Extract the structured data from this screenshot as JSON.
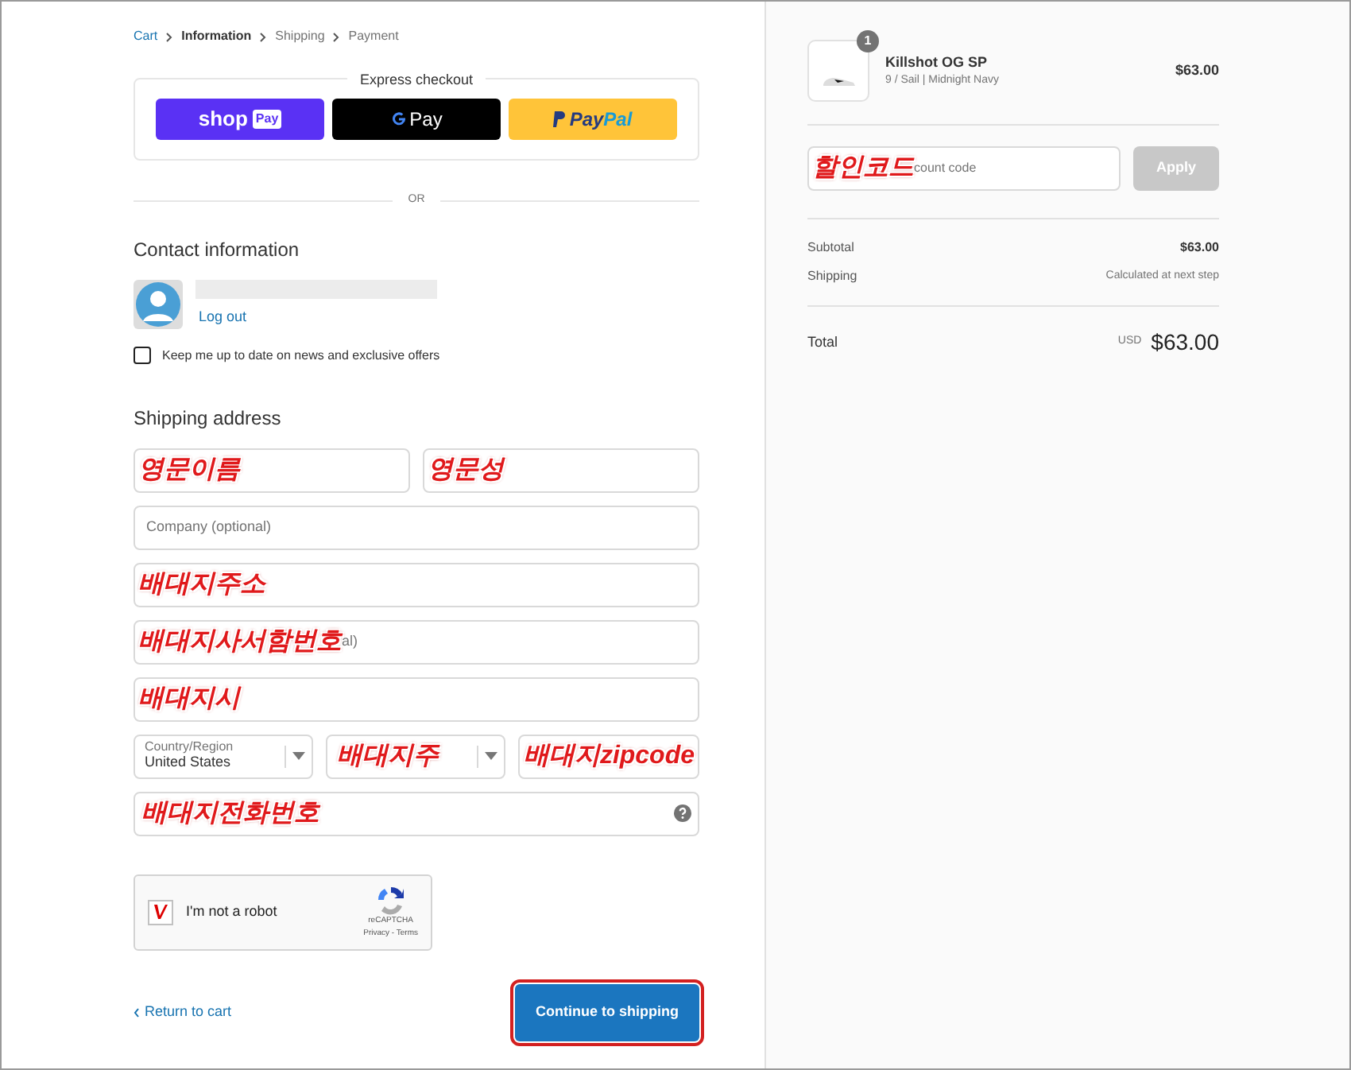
{
  "breadcrumbs": [
    {
      "label": "Cart",
      "kind": "link"
    },
    {
      "label": "Information",
      "kind": "current"
    },
    {
      "label": "Shipping",
      "kind": "future"
    },
    {
      "label": "Payment",
      "kind": "future"
    }
  ],
  "express_checkout": {
    "title": "Express checkout",
    "buttons": [
      {
        "kind": "shop",
        "label": "shop",
        "badge": "Pay"
      },
      {
        "kind": "gpay",
        "label": "Pay"
      },
      {
        "kind": "paypal",
        "label": "Pay",
        "label2": "Pal"
      }
    ]
  },
  "divider": "OR",
  "contact": {
    "title": "Contact information",
    "logout": "Log out",
    "newsletter": {
      "label": "Keep me up to date on news and exclusive offers",
      "checked": false
    }
  },
  "shipping": {
    "title": "Shipping address",
    "fields": [
      {
        "kind": "half",
        "annotation": "영문이름"
      },
      {
        "kind": "half",
        "annotation": "영문성"
      },
      {
        "kind": "text",
        "placeholder": "Company (optional)"
      },
      {
        "kind": "text",
        "annotation": "배대지주소"
      },
      {
        "kind": "text",
        "annotation": "배대지사서함번호",
        "fragment": "al)"
      },
      {
        "kind": "text",
        "annotation": "배대지시"
      },
      {
        "kind": "select",
        "label": "Country/Region",
        "value": "United States"
      },
      {
        "kind": "select",
        "annotation": "배대지주"
      },
      {
        "kind": "third",
        "annotation": "배대지zipcode"
      },
      {
        "kind": "phone",
        "annotation": "배대지전화번호"
      }
    ]
  },
  "captcha": {
    "checked": true,
    "label": "I'm not a robot",
    "brand": "reCAPTCHA",
    "links": "Privacy - Terms"
  },
  "return_link": "Return to cart",
  "continue_button": "Continue to shipping",
  "order": {
    "item": {
      "name": "Killshot OG SP",
      "variant": "9 / Sail | Midnight Navy",
      "price": "$63.00",
      "quantity": "1"
    },
    "discount": {
      "annotation": "할인코드",
      "fragment": "count code",
      "button": "Apply"
    },
    "rows": [
      {
        "label": "Subtotal",
        "value": "$63.00",
        "kind": "bold"
      },
      {
        "label": "Shipping",
        "value": "Calculated at next step",
        "kind": "note"
      }
    ],
    "total": {
      "label": "Total",
      "currency": "USD",
      "value": "$63.00"
    }
  }
}
